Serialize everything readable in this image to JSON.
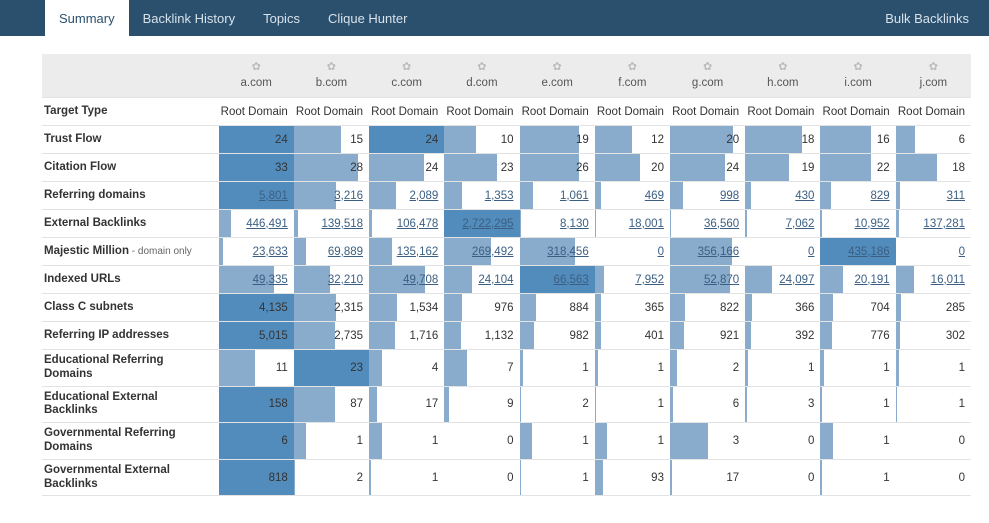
{
  "header": {
    "tabs": [
      "Summary",
      "Backlink History",
      "Topics",
      "Clique Hunter"
    ],
    "active_tab": 0,
    "right_link": "Bulk Backlinks"
  },
  "columns": [
    "a.com",
    "b.com",
    "c.com",
    "d.com",
    "e.com",
    "f.com",
    "g.com",
    "h.com",
    "i.com",
    "j.com"
  ],
  "gear_icon": "✿",
  "chart_data": {
    "type": "table",
    "columns": [
      "a.com",
      "b.com",
      "c.com",
      "d.com",
      "e.com",
      "f.com",
      "g.com",
      "h.com",
      "i.com",
      "j.com"
    ],
    "rows": [
      {
        "label": "Target Type",
        "sub": "",
        "type": "text",
        "link": false,
        "values": [
          "Root Domain",
          "Root Domain",
          "Root Domain",
          "Root Domain",
          "Root Domain",
          "Root Domain",
          "Root Domain",
          "Root Domain",
          "Root Domain",
          "Root Domain"
        ]
      },
      {
        "label": "Trust Flow",
        "sub": "",
        "type": "bar",
        "link": false,
        "values": [
          24,
          15,
          24,
          10,
          19,
          12,
          20,
          18,
          16,
          6
        ],
        "max": 24,
        "dark": [
          0,
          2
        ]
      },
      {
        "label": "Citation Flow",
        "sub": "",
        "type": "bar",
        "link": false,
        "values": [
          33,
          28,
          24,
          23,
          26,
          20,
          24,
          19,
          22,
          18
        ],
        "max": 33,
        "dark": [
          0
        ]
      },
      {
        "label": "Referring domains",
        "sub": "",
        "type": "bar",
        "link": true,
        "values": [
          5801,
          3216,
          2089,
          1353,
          1061,
          469,
          998,
          430,
          829,
          311
        ],
        "display": [
          "5,801",
          "3,216",
          "2,089",
          "1,353",
          "1,061",
          "469",
          "998",
          "430",
          "829",
          "311"
        ],
        "max": 5801,
        "dark": [
          0
        ]
      },
      {
        "label": "External Backlinks",
        "sub": "",
        "type": "bar",
        "link": true,
        "values": [
          446491,
          139518,
          106478,
          2722295,
          8130,
          18001,
          36560,
          7062,
          10952,
          137281
        ],
        "display": [
          "446,491",
          "139,518",
          "106,478",
          "2,722,295",
          "8,130",
          "18,001",
          "36,560",
          "7,062",
          "10,952",
          "137,281"
        ],
        "max": 2722295,
        "dark": [
          3
        ]
      },
      {
        "label": "Majestic Million",
        "sub": " - domain only",
        "type": "bar",
        "link": true,
        "values": [
          23633,
          69889,
          135162,
          269492,
          318456,
          0,
          356166,
          0,
          435186,
          0
        ],
        "display": [
          "23,633",
          "69,889",
          "135,162",
          "269,492",
          "318,456",
          "0",
          "356,166",
          "0",
          "435,186",
          "0"
        ],
        "max": 435186,
        "dark": [
          8
        ]
      },
      {
        "label": "Indexed URLs",
        "sub": "",
        "type": "bar",
        "link": true,
        "values": [
          49335,
          32210,
          49708,
          24104,
          66563,
          7952,
          52870,
          24097,
          20191,
          16011
        ],
        "display": [
          "49,335",
          "32,210",
          "49,708",
          "24,104",
          "66,563",
          "7,952",
          "52,870",
          "24,097",
          "20,191",
          "16,011"
        ],
        "max": 66563,
        "dark": [
          4
        ]
      },
      {
        "label": "Class C subnets",
        "sub": "",
        "type": "bar",
        "link": false,
        "values": [
          4135,
          2315,
          1534,
          976,
          884,
          365,
          822,
          366,
          704,
          285
        ],
        "display": [
          "4,135",
          "2,315",
          "1,534",
          "976",
          "884",
          "365",
          "822",
          "366",
          "704",
          "285"
        ],
        "max": 4135,
        "dark": [
          0
        ]
      },
      {
        "label": "Referring IP addresses",
        "sub": "",
        "type": "bar",
        "link": false,
        "values": [
          5015,
          2735,
          1716,
          1132,
          982,
          401,
          921,
          392,
          776,
          302
        ],
        "display": [
          "5,015",
          "2,735",
          "1,716",
          "1,132",
          "982",
          "401",
          "921",
          "392",
          "776",
          "302"
        ],
        "max": 5015,
        "dark": [
          0
        ]
      },
      {
        "label": "Educational Referring Domains",
        "sub": "",
        "type": "bar",
        "link": false,
        "tall": true,
        "values": [
          11,
          23,
          4,
          7,
          1,
          1,
          2,
          1,
          1,
          1
        ],
        "max": 23,
        "dark": [
          1
        ]
      },
      {
        "label": "Educational External Backlinks",
        "sub": "",
        "type": "bar",
        "link": false,
        "values": [
          158,
          87,
          17,
          9,
          2,
          1,
          6,
          3,
          1,
          1
        ],
        "max": 158,
        "dark": [
          0
        ]
      },
      {
        "label": "Governmental Referring Domains",
        "sub": "",
        "type": "bar",
        "link": false,
        "tall": true,
        "values": [
          6,
          1,
          1,
          0,
          1,
          1,
          3,
          0,
          1,
          0
        ],
        "max": 6,
        "dark": [
          0
        ]
      },
      {
        "label": "Governmental External Backlinks",
        "sub": "",
        "type": "bar",
        "link": false,
        "tall": true,
        "values": [
          818,
          2,
          1,
          0,
          1,
          93,
          17,
          0,
          1,
          0
        ],
        "max": 818,
        "dark": [
          0
        ]
      }
    ]
  }
}
